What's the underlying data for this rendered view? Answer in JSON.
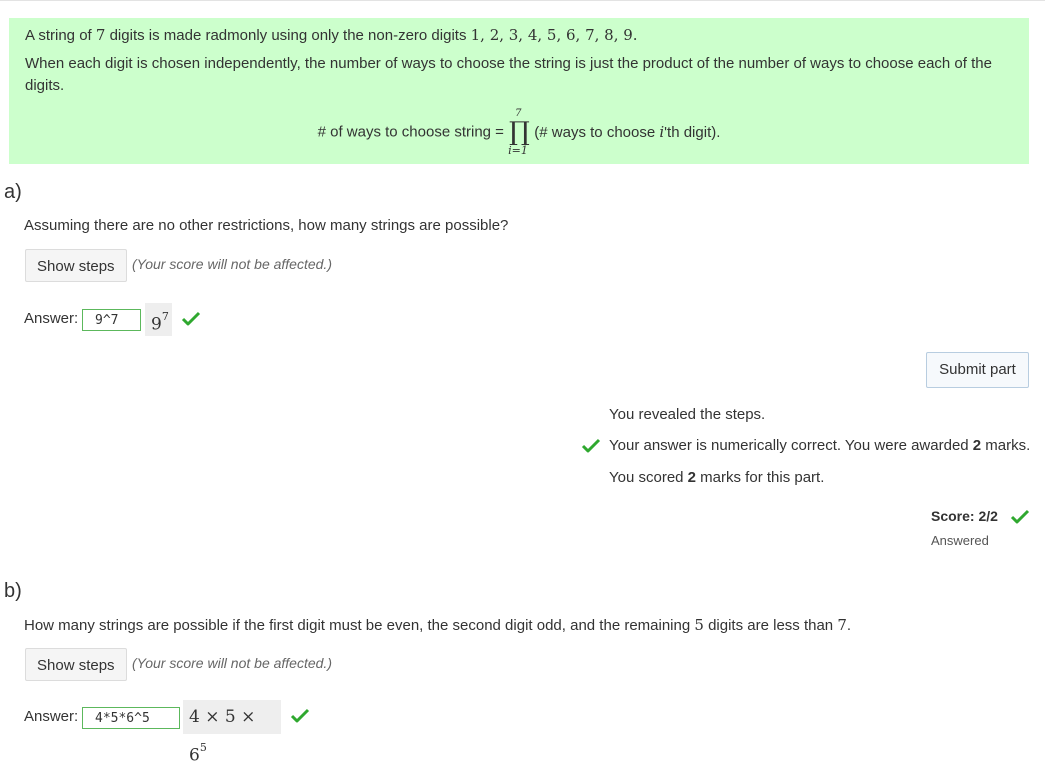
{
  "intro": {
    "line1_prefix": "A string of ",
    "line1_num": "7",
    "line1_mid": " digits is made radmonly using only the non-zero digits ",
    "line1_digits": "1, 2, 3, 4, 5, 6, 7, 8, 9.",
    "line2": "When each digit is chosen independently, the number of ways to choose the string is just the product of the number of ways to choose each of the",
    "line3": "digits.",
    "formula_lhs": "# of ways to choose string =",
    "formula_prod_upper": "7",
    "formula_prod_lower": "i=1",
    "formula_rhs_pre": "(# ways to choose ",
    "formula_rhs_var": "i",
    "formula_rhs_post": "'th digit)."
  },
  "part_a": {
    "label": "a)",
    "question": "Assuming there are no other restrictions, how many strings are possible?",
    "show_steps": "Show steps",
    "score_note": "(Your score will not be affected.)",
    "answer_label": "Answer:",
    "answer_value": "9^7",
    "preview_base": "9",
    "preview_exp": "7",
    "submit": "Submit part",
    "feedback_revealed": "You revealed the steps.",
    "feedback_correct_pre": "Your answer is numerically correct. You were awarded ",
    "feedback_correct_marks": "2",
    "feedback_correct_post": " marks.",
    "feedback_scored_pre": "You scored ",
    "feedback_scored_marks": "2",
    "feedback_scored_post": " marks for this part.",
    "score": "Score: 2/2",
    "status": "Answered"
  },
  "part_b": {
    "label": "b)",
    "question_pre": "How many strings are possible if the first digit must be even, the second digit odd, and the remaining ",
    "question_num": "5",
    "question_mid": " digits are less than ",
    "question_num2": "7",
    "question_post": ".",
    "show_steps": "Show steps",
    "score_note": "(Your score will not be affected.)",
    "answer_label": "Answer:",
    "answer_value": "4*5*6^5",
    "preview_main": "4 × 5 × 6",
    "preview_exp": "5"
  },
  "colors": {
    "correct": "#2fa82f",
    "intro_bg": "#ccffcc"
  }
}
